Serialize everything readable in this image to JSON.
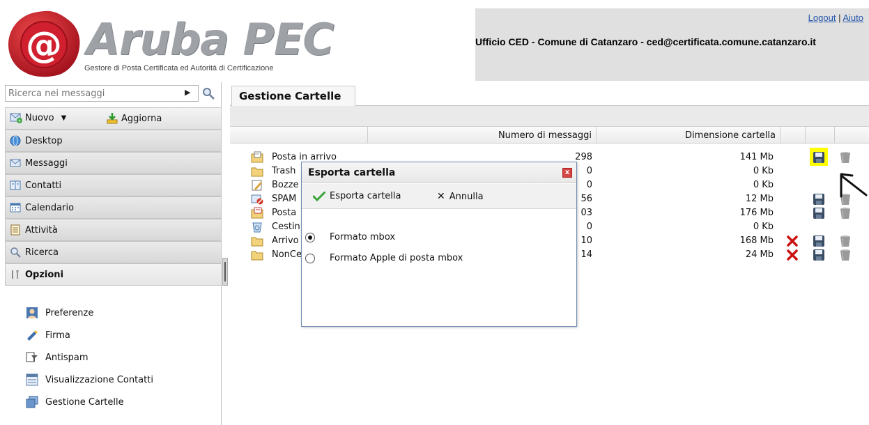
{
  "header": {
    "brand": "Aruba PEC",
    "tagline": "Gestore di Posta Certificata ed Autorità di Certificazione",
    "logout": "Logout",
    "separator": "|",
    "help": "Aiuto",
    "user": "Ufficio CED - Comune di Catanzaro - ced@certificata.comune.catanzaro.it"
  },
  "search": {
    "placeholder": "Ricerca nei messaggi"
  },
  "toolbar": {
    "new_label": "Nuovo",
    "refresh_label": "Aggiorna"
  },
  "nav": [
    {
      "label": "Desktop"
    },
    {
      "label": "Messaggi"
    },
    {
      "label": "Contatti"
    },
    {
      "label": "Calendario"
    },
    {
      "label": "Attività"
    },
    {
      "label": "Ricerca"
    },
    {
      "label": "Opzioni"
    }
  ],
  "options": [
    {
      "label": "Preferenze"
    },
    {
      "label": "Firma"
    },
    {
      "label": "Antispam"
    },
    {
      "label": "Visualizzazione Contatti"
    },
    {
      "label": "Gestione Cartelle"
    }
  ],
  "main": {
    "tab": "Gestione Cartelle",
    "col_messages": "Numero di messaggi",
    "col_size": "Dimensione cartella"
  },
  "folders": [
    {
      "name": "Posta in arrivo",
      "count": "298",
      "size": "141 Mb"
    },
    {
      "name": "Trash",
      "count": "0",
      "size": "0 Kb"
    },
    {
      "name": "Bozze",
      "count": "0",
      "size": "0 Kb"
    },
    {
      "name": "SPAM",
      "count": "56",
      "size": "12 Mb"
    },
    {
      "name": "Posta",
      "count": "03",
      "size": "176 Mb"
    },
    {
      "name": "Cestin",
      "count": "0",
      "size": "0 Kb"
    },
    {
      "name": "Arrivo",
      "count": "10",
      "size": "168 Mb"
    },
    {
      "name": "NonCe",
      "count": "14",
      "size": "24 Mb"
    }
  ],
  "dialog": {
    "title": "Esporta cartella",
    "close": "x",
    "export_label": "Esporta cartella",
    "cancel_label": "Annulla",
    "option1": "Formato mbox",
    "option2": "Formato Apple di posta mbox"
  },
  "colors": {
    "highlight": "#ffff00",
    "delete": "#cc1111",
    "brand_red": "#c8102e"
  }
}
